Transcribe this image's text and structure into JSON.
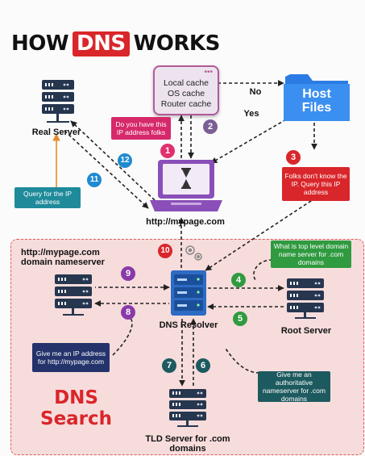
{
  "title": {
    "pre": "HOW",
    "highlight": "DNS",
    "post": "WORKS"
  },
  "cache_box": {
    "line1": "Local cache",
    "line2": "OS cache",
    "line3": "Router cache"
  },
  "host_files": {
    "line1": "Host",
    "line2": "Files"
  },
  "labels": {
    "real_server": "Real Server",
    "browser_url": "http://mypage.com",
    "domain_ns_line1": "http://mypage.com",
    "domain_ns_line2": "domain nameserver",
    "dns_resolver": "DNS Resolver",
    "root_server": "Root Server",
    "tld_line1": "TLD Server for .com",
    "tld_line2": "domains",
    "no": "No",
    "yes": "Yes",
    "dns_search_line1": "DNS",
    "dns_search_line2": "Search"
  },
  "notes": {
    "ip_question": "Do you have this IP address folks",
    "folks_dont_know": "Folks don't know the IP. Query this IP address",
    "query_ip": "Query for the IP address",
    "top_level": "What is top level domain name server for .com domains",
    "give_ip": "Give me an IP address for http://mypage.com",
    "authoritative": "Give me an authoritative nameserver for .com domains"
  },
  "steps": [
    "1",
    "2",
    "3",
    "4",
    "5",
    "6",
    "7",
    "8",
    "9",
    "10",
    "11",
    "12"
  ],
  "colors": {
    "brand_red": "#d9262a",
    "note_pink": "#d6286a",
    "note_red": "#d9262a",
    "note_teal": "#1f8a9a",
    "note_green": "#2f9a3f",
    "note_navy": "#24336b",
    "note_darkteal": "#1d5a5f",
    "server_navy": "#27364f",
    "resolver_blue": "#2d6cc4",
    "laptop_purple": "#8a4fb8",
    "folder_blue": "#2c7be5"
  }
}
